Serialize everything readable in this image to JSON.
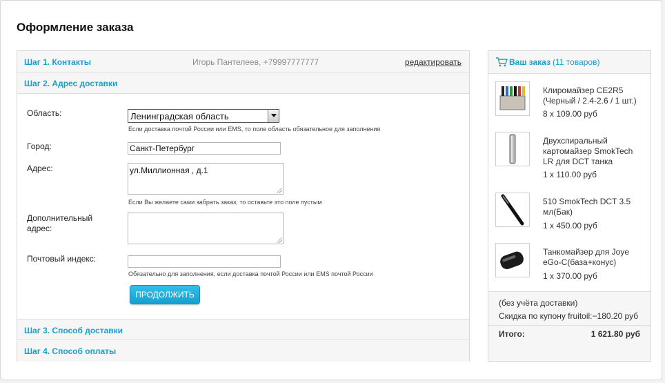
{
  "page": {
    "title": "Оформление заказа"
  },
  "steps": [
    {
      "title": "Шаг 1. Контакты",
      "summary": "Игорь Пантелеев, +79997777777",
      "edit_label": "редактировать"
    },
    {
      "title": "Шаг 2. Адрес доставки"
    },
    {
      "title": "Шаг 3. Способ доставки"
    },
    {
      "title": "Шаг 4. Способ оплаты"
    }
  ],
  "form": {
    "region": {
      "label": "Область:",
      "value": "Ленинградская область",
      "hint": "Если доставка почтой России или EMS, то поле область обязательное для заполнения"
    },
    "city": {
      "label": "Город:",
      "value": "Санкт-Петербург"
    },
    "address": {
      "label": "Адрес:",
      "value": "ул.Миллионная , д.1",
      "hint": "Если Вы желаете сами забрать заказ, то оставьте это поле пустым"
    },
    "extra_address": {
      "label_line1": "Дополнительный",
      "label_line2": "адрес:",
      "value": ""
    },
    "postcode": {
      "label": "Почтовый индекс:",
      "value": "",
      "hint": "Обязательно для заполнения, если доставка почтой России или EMS почтой России"
    },
    "continue_label": "ПРОДОЛЖИТЬ"
  },
  "order": {
    "title": "Ваш заказ",
    "count": "(11 товаров)",
    "items": [
      {
        "name_lines": [
          "Клиромайзер CE2R5",
          "(Черный / 2.4-2.6 / 1 шт.)"
        ],
        "qty": "8 x 109.00 руб"
      },
      {
        "name_lines": [
          "Двухспиральный",
          "картомайзер SmokTech",
          "LR для DCT танка"
        ],
        "qty": "1 x 110.00 руб"
      },
      {
        "name_lines": [
          "510 SmokTech DCT 3.5",
          "мл(Бак)"
        ],
        "qty": "1 x 450.00 руб"
      },
      {
        "name_lines": [
          "Танкомайзер для Joye",
          "eGo-C(база+конус)"
        ],
        "qty": "1 x 370.00 руб"
      }
    ],
    "no_delivery_note": "(без учёта доставки)",
    "discount": "Скидка по купону fruitoil:−180.20 руб",
    "total_label": "Итого:",
    "total_value": "1 621.80 руб"
  },
  "colors": {
    "accent": "#1a9fc8",
    "button": "#21ade0"
  }
}
